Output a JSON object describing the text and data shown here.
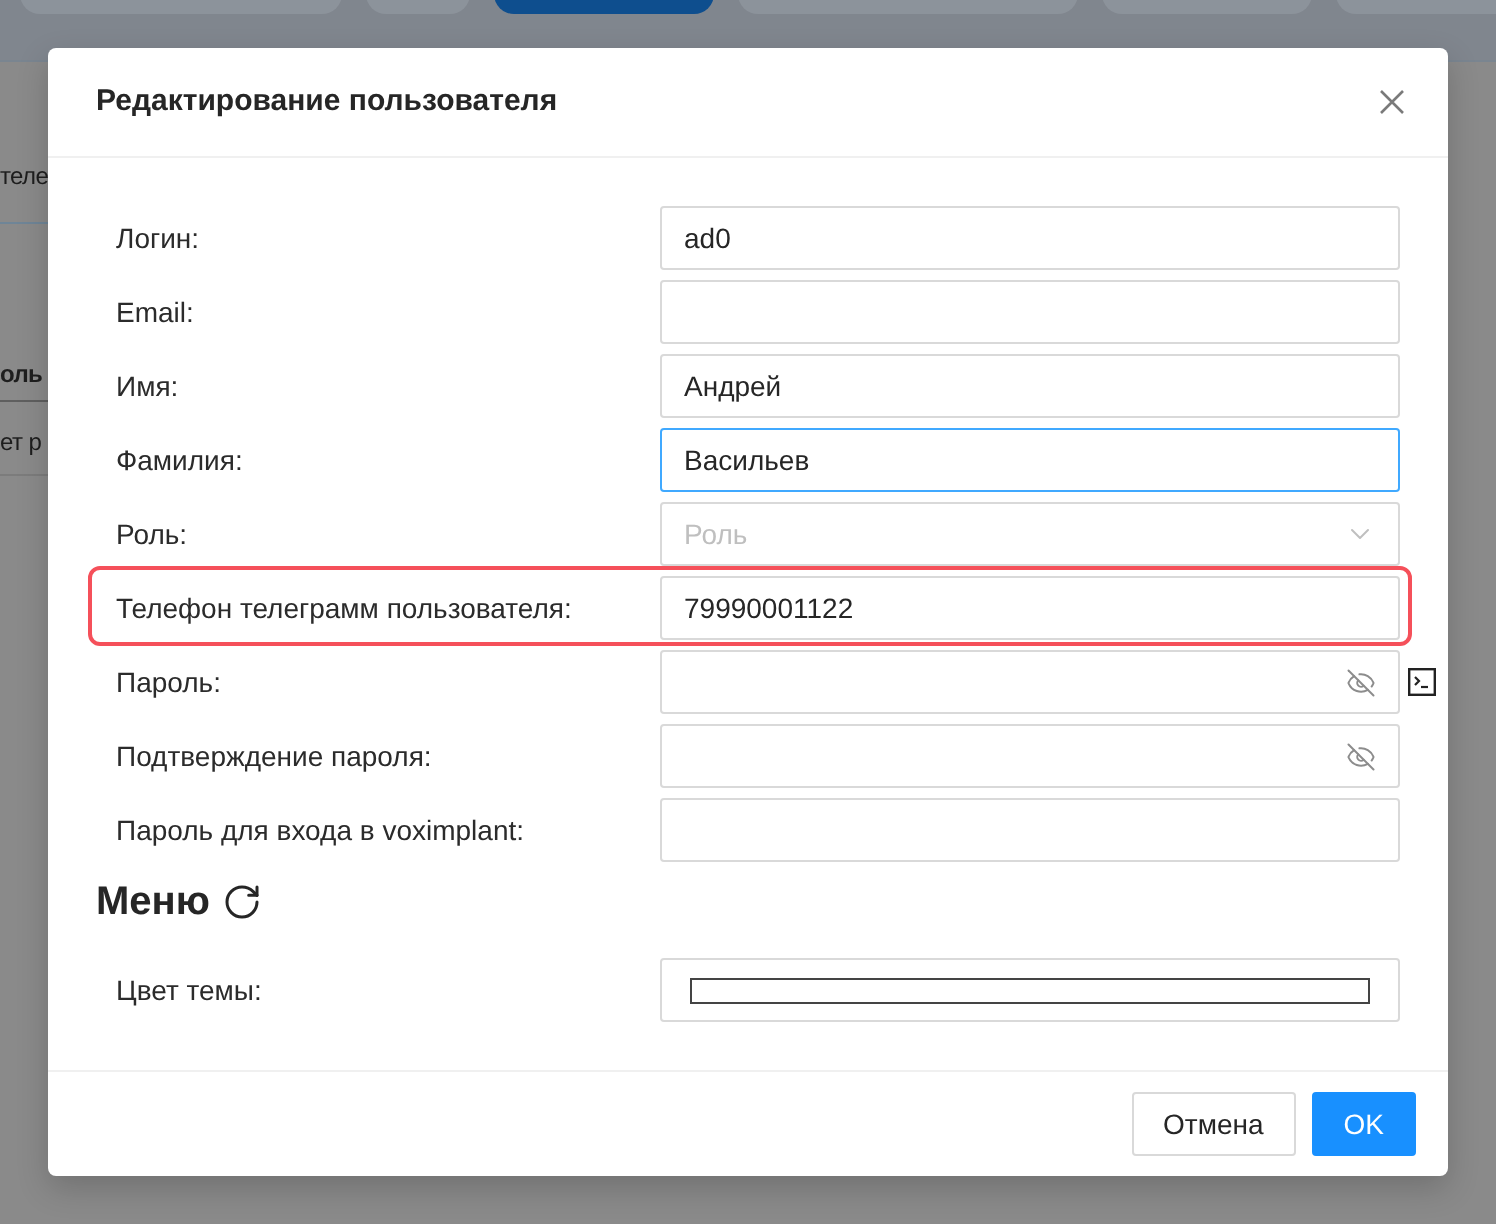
{
  "page_behind": {
    "tabs": [
      {
        "selected": false
      },
      {
        "selected": false
      },
      {
        "selected": true
      },
      {
        "selected": false
      },
      {
        "selected": false
      },
      {
        "selected": false
      }
    ],
    "text_fragment": "теле",
    "table_header": "оль",
    "table_cell": "ет р"
  },
  "dialog": {
    "title": "Редактирование пользователя",
    "fields": [
      {
        "label": "Логин:",
        "kind": "text",
        "value": "ad0",
        "focused": false,
        "highlighted": false,
        "terminal_button": false
      },
      {
        "label": "Email:",
        "kind": "text",
        "focused": false,
        "highlighted": false,
        "terminal_button": false
      },
      {
        "label": "Имя:",
        "kind": "text",
        "value": "Андрей",
        "focused": false,
        "highlighted": false,
        "terminal_button": false
      },
      {
        "label": "Фамилия:",
        "kind": "text",
        "value": "Васильев",
        "focused": true,
        "highlighted": false,
        "terminal_button": false
      },
      {
        "label": "Роль:",
        "kind": "select",
        "placeholder": "Роль",
        "focused": false,
        "highlighted": false,
        "terminal_button": false
      },
      {
        "label": "Телефон телеграмм пользователя:",
        "kind": "text",
        "value": "79990001122",
        "focused": false,
        "highlighted": true,
        "terminal_button": false
      },
      {
        "label": "Пароль:",
        "kind": "password",
        "focused": false,
        "highlighted": false,
        "terminal_button": true
      },
      {
        "label": "Подтверждение пароля:",
        "kind": "password",
        "focused": false,
        "highlighted": false,
        "terminal_button": false
      },
      {
        "label": "Пароль для входа в voximplant:",
        "kind": "text",
        "focused": false,
        "highlighted": false,
        "terminal_button": false
      }
    ],
    "menu": {
      "title": "Меню",
      "fields": [
        {
          "label": "Цвет темы:",
          "kind": "color",
          "focused": false,
          "highlighted": false,
          "terminal_button": false
        }
      ]
    },
    "buttons": [
      {
        "label": "Отмена",
        "kind": "default"
      },
      {
        "label": "OK",
        "kind": "primary"
      }
    ]
  }
}
